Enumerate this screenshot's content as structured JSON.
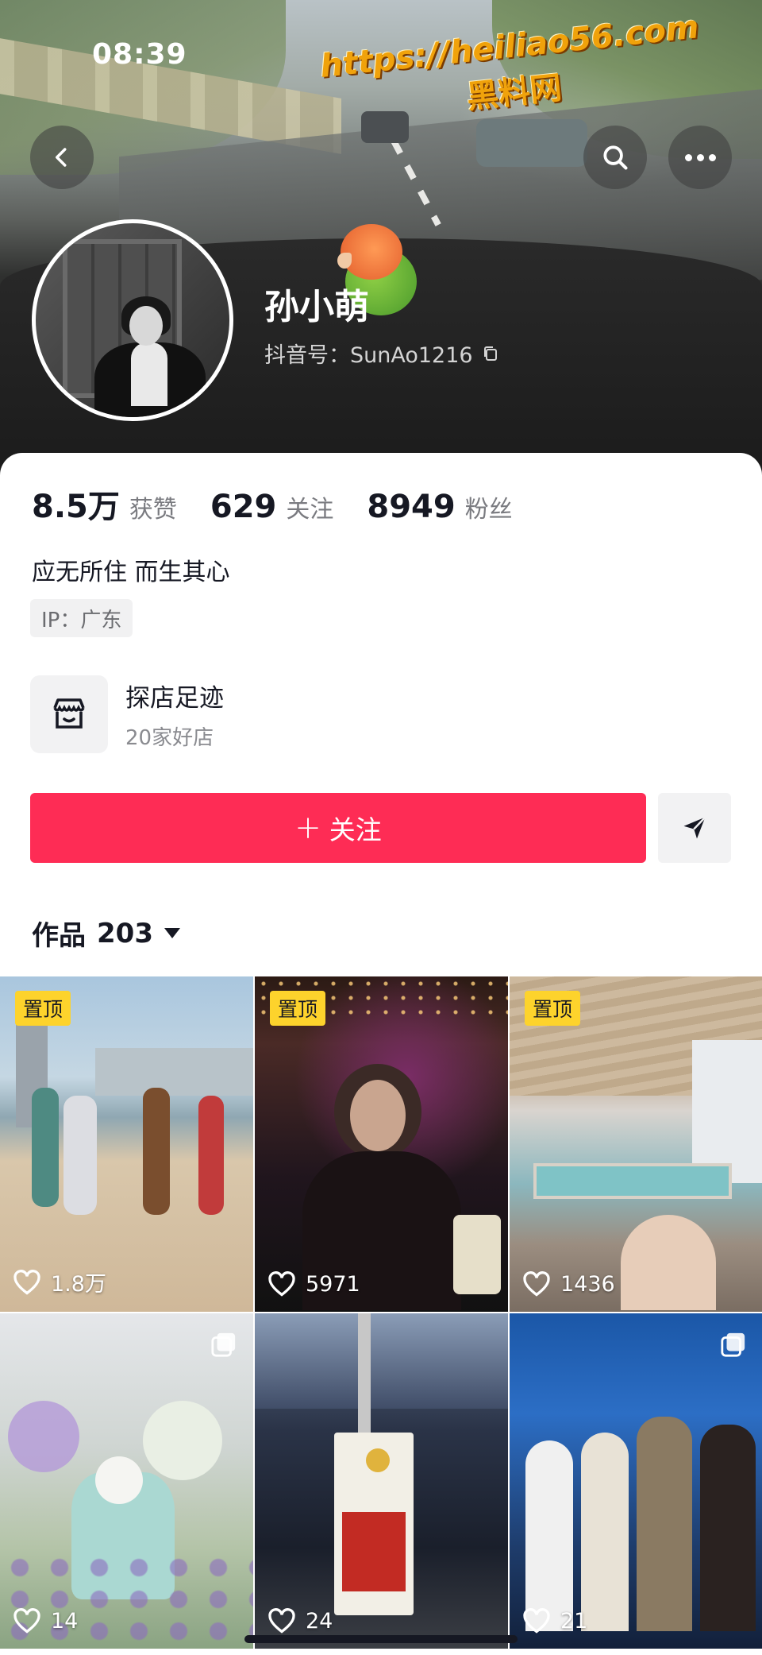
{
  "status_bar": {
    "time": "08:39"
  },
  "watermark": {
    "url": "https://heiliao56.com",
    "site": "黑料网"
  },
  "header": {
    "back_icon": "chevron-left-icon",
    "search_icon": "search-icon",
    "more_icon": "more-dots-icon"
  },
  "profile": {
    "name": "孙小萌",
    "douyin_id_label": "抖音号：SunAo1216",
    "stats": [
      {
        "value": "8.5万",
        "label": "获赞"
      },
      {
        "value": "629",
        "label": "关注"
      },
      {
        "value": "8949",
        "label": "粉丝"
      }
    ],
    "bio": "应无所住 而生其心",
    "ip": "IP：广东"
  },
  "visits": {
    "title": "探店足迹",
    "subtitle": "20家好店",
    "icon": "shop-icon"
  },
  "actions": {
    "follow_plus": "+",
    "follow_label": "关注",
    "share_icon": "send-icon"
  },
  "works": {
    "label": "作品",
    "count": "203",
    "items": [
      {
        "pinned": true,
        "pin_label": "置顶",
        "likes": "1.8万",
        "multi": false
      },
      {
        "pinned": true,
        "pin_label": "置顶",
        "likes": "5971",
        "multi": false
      },
      {
        "pinned": true,
        "pin_label": "置顶",
        "likes": "1436",
        "multi": false
      },
      {
        "pinned": false,
        "pin_label": "",
        "likes": "14",
        "multi": true
      },
      {
        "pinned": false,
        "pin_label": "",
        "likes": "24",
        "multi": false
      },
      {
        "pinned": false,
        "pin_label": "",
        "likes": "21",
        "multi": true
      }
    ]
  },
  "colors": {
    "accent": "#fe2c55",
    "pin_badge": "#fdd32c",
    "text": "#161823"
  }
}
